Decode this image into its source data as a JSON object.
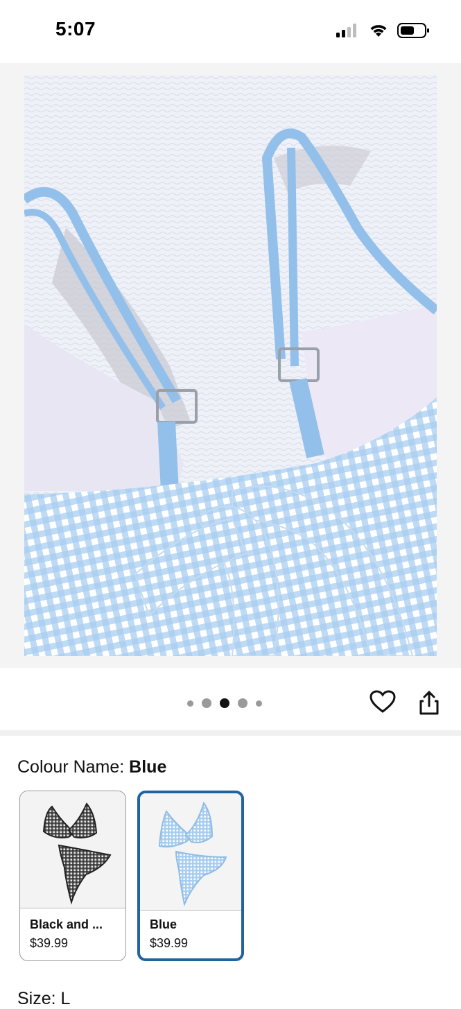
{
  "status_bar": {
    "time": "5:07",
    "icons": [
      "cellular-signal-icon",
      "wifi-icon",
      "battery-icon"
    ]
  },
  "product_image": {
    "alt": "Blue gingham bikini top back view",
    "carousel_total": 5,
    "carousel_active_index": 2
  },
  "actions": {
    "icons": [
      "heart-icon",
      "share-icon"
    ]
  },
  "colour": {
    "label": "Colour Name: ",
    "selected": "Blue",
    "options": [
      {
        "name": "Black and ...",
        "price": "$39.99",
        "selected": false,
        "color": "#3a3a3a"
      },
      {
        "name": "Blue",
        "price": "$39.99",
        "selected": true,
        "color": "#9cc4ea"
      }
    ]
  },
  "size": {
    "label": "Size: L"
  },
  "colors": {
    "accent": "#2162a1",
    "gingham_blue": "#9cc4ea"
  }
}
